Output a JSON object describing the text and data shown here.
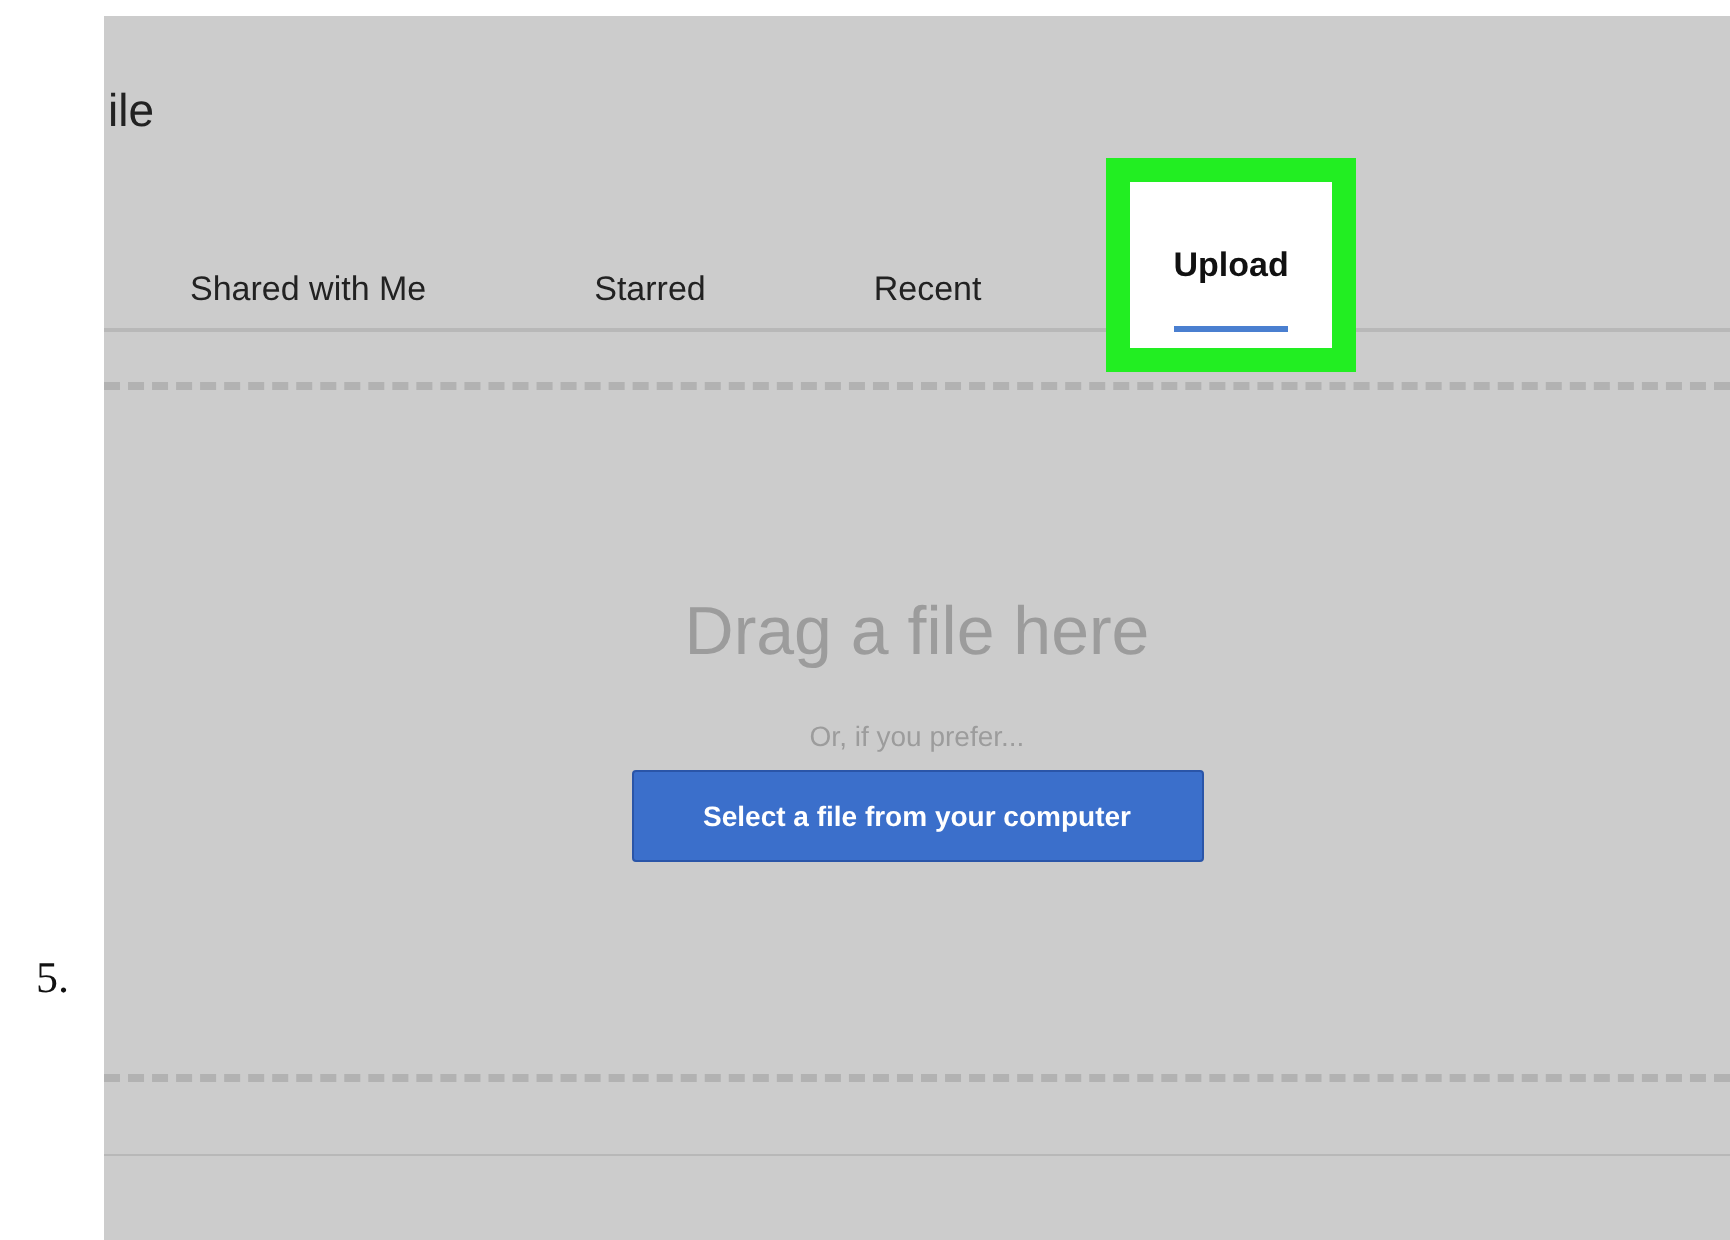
{
  "step_number": "5.",
  "window": {
    "title": "ile"
  },
  "tabs": [
    {
      "label": "Shared with Me",
      "selected": false
    },
    {
      "label": "Starred",
      "selected": false
    },
    {
      "label": "Recent",
      "selected": false
    },
    {
      "label": "Upload",
      "selected": true,
      "highlighted": true
    }
  ],
  "dropzone": {
    "heading": "Drag a file here",
    "hint": "Or, if you prefer...",
    "button": "Select a file from your computer"
  }
}
